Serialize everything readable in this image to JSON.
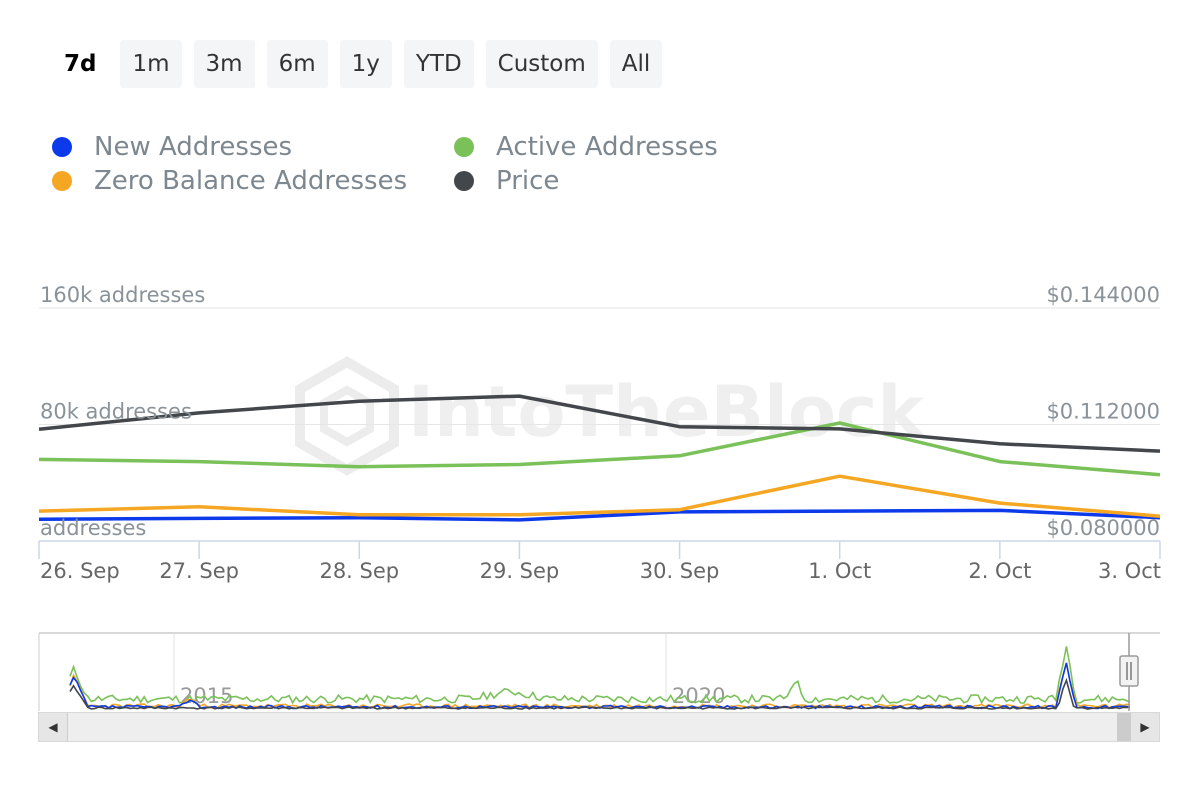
{
  "range_selector": {
    "buttons": [
      {
        "label": "7d",
        "active": true
      },
      {
        "label": "1m",
        "active": false
      },
      {
        "label": "3m",
        "active": false
      },
      {
        "label": "6m",
        "active": false
      },
      {
        "label": "1y",
        "active": false
      },
      {
        "label": "YTD",
        "active": false
      },
      {
        "label": "Custom",
        "active": false
      },
      {
        "label": "All",
        "active": false
      }
    ]
  },
  "watermark": "IntoTheBlock",
  "chart_data": {
    "type": "line",
    "x": [
      "26. Sep",
      "27. Sep",
      "28. Sep",
      "29. Sep",
      "30. Sep",
      "1. Oct",
      "2. Oct",
      "3. Oct"
    ],
    "y_left": {
      "ylim": [
        0,
        160000
      ],
      "ticks": [
        {
          "value": 0,
          "label": "addresses"
        },
        {
          "value": 80000,
          "label": "80k addresses"
        },
        {
          "value": 160000,
          "label": "160k addresses"
        }
      ]
    },
    "y_right": {
      "ylim": [
        0.08,
        0.144
      ],
      "ticks": [
        {
          "value": 0.08,
          "label": "$0.080000"
        },
        {
          "value": 0.112,
          "label": "$0.112000"
        },
        {
          "value": 0.144,
          "label": "$0.144000"
        }
      ]
    },
    "series": [
      {
        "name": "New Addresses",
        "axis": "left",
        "color": "#0c3aea",
        "values": [
          15000,
          15500,
          16000,
          14500,
          20000,
          20500,
          21000,
          16000
        ]
      },
      {
        "name": "Active Addresses",
        "axis": "left",
        "color": "#7ac15a",
        "values": [
          56000,
          54500,
          51000,
          52500,
          58500,
          81000,
          54500,
          45500
        ]
      },
      {
        "name": "Zero Balance Addresses",
        "axis": "left",
        "color": "#f5a623",
        "values": [
          20500,
          23500,
          18000,
          18000,
          21500,
          44500,
          26000,
          17000
        ]
      },
      {
        "name": "Price",
        "axis": "right",
        "color": "#43474b",
        "values": [
          0.1107,
          0.1152,
          0.1184,
          0.1198,
          0.1114,
          0.1108,
          0.1067,
          0.1047
        ]
      }
    ],
    "grid": true,
    "legend_position": "top-left",
    "navigator": {
      "labels": [
        "2015",
        "2020"
      ]
    }
  }
}
